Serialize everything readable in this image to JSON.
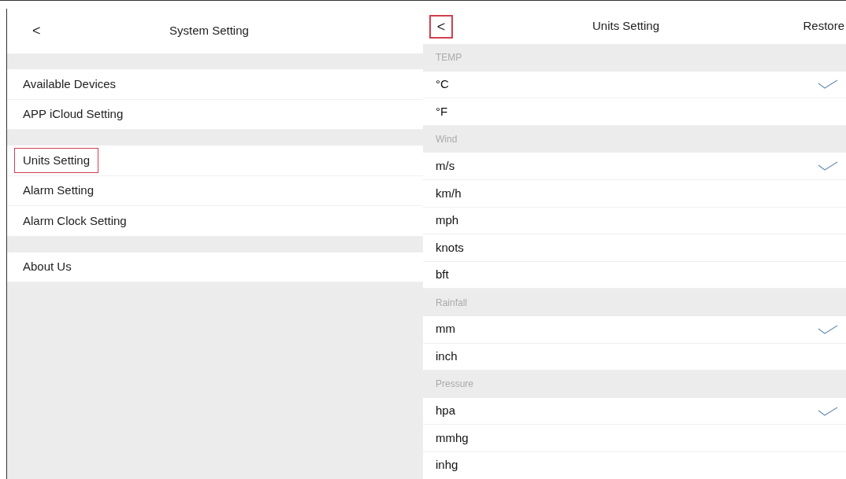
{
  "left": {
    "back": {
      "label": "<",
      "highlighted": false
    },
    "title": "System Setting",
    "groups": [
      {
        "items": [
          {
            "label": "Available Devices",
            "highlighted": false
          },
          {
            "label": "APP iCloud Setting",
            "highlighted": false
          }
        ]
      },
      {
        "items": [
          {
            "label": "Units Setting",
            "highlighted": true
          },
          {
            "label": "Alarm Setting",
            "highlighted": false
          },
          {
            "label": "Alarm Clock Setting",
            "highlighted": false
          }
        ]
      },
      {
        "items": [
          {
            "label": "About Us",
            "highlighted": false
          }
        ]
      }
    ]
  },
  "right": {
    "back": {
      "label": "<",
      "highlighted": true
    },
    "title": "Units Setting",
    "action": "Restore",
    "sections": [
      {
        "title": "TEMP",
        "options": [
          {
            "label": "°C",
            "selected": true
          },
          {
            "label": "°F",
            "selected": false
          }
        ]
      },
      {
        "title": "Wind",
        "options": [
          {
            "label": "m/s",
            "selected": true
          },
          {
            "label": "km/h",
            "selected": false
          },
          {
            "label": "mph",
            "selected": false
          },
          {
            "label": "knots",
            "selected": false
          },
          {
            "label": "bft",
            "selected": false
          }
        ]
      },
      {
        "title": "Rainfall",
        "options": [
          {
            "label": "mm",
            "selected": true
          },
          {
            "label": "inch",
            "selected": false
          }
        ]
      },
      {
        "title": "Pressure",
        "options": [
          {
            "label": "hpa",
            "selected": true
          },
          {
            "label": "mmhg",
            "selected": false
          },
          {
            "label": "inhg",
            "selected": false
          }
        ]
      }
    ]
  }
}
